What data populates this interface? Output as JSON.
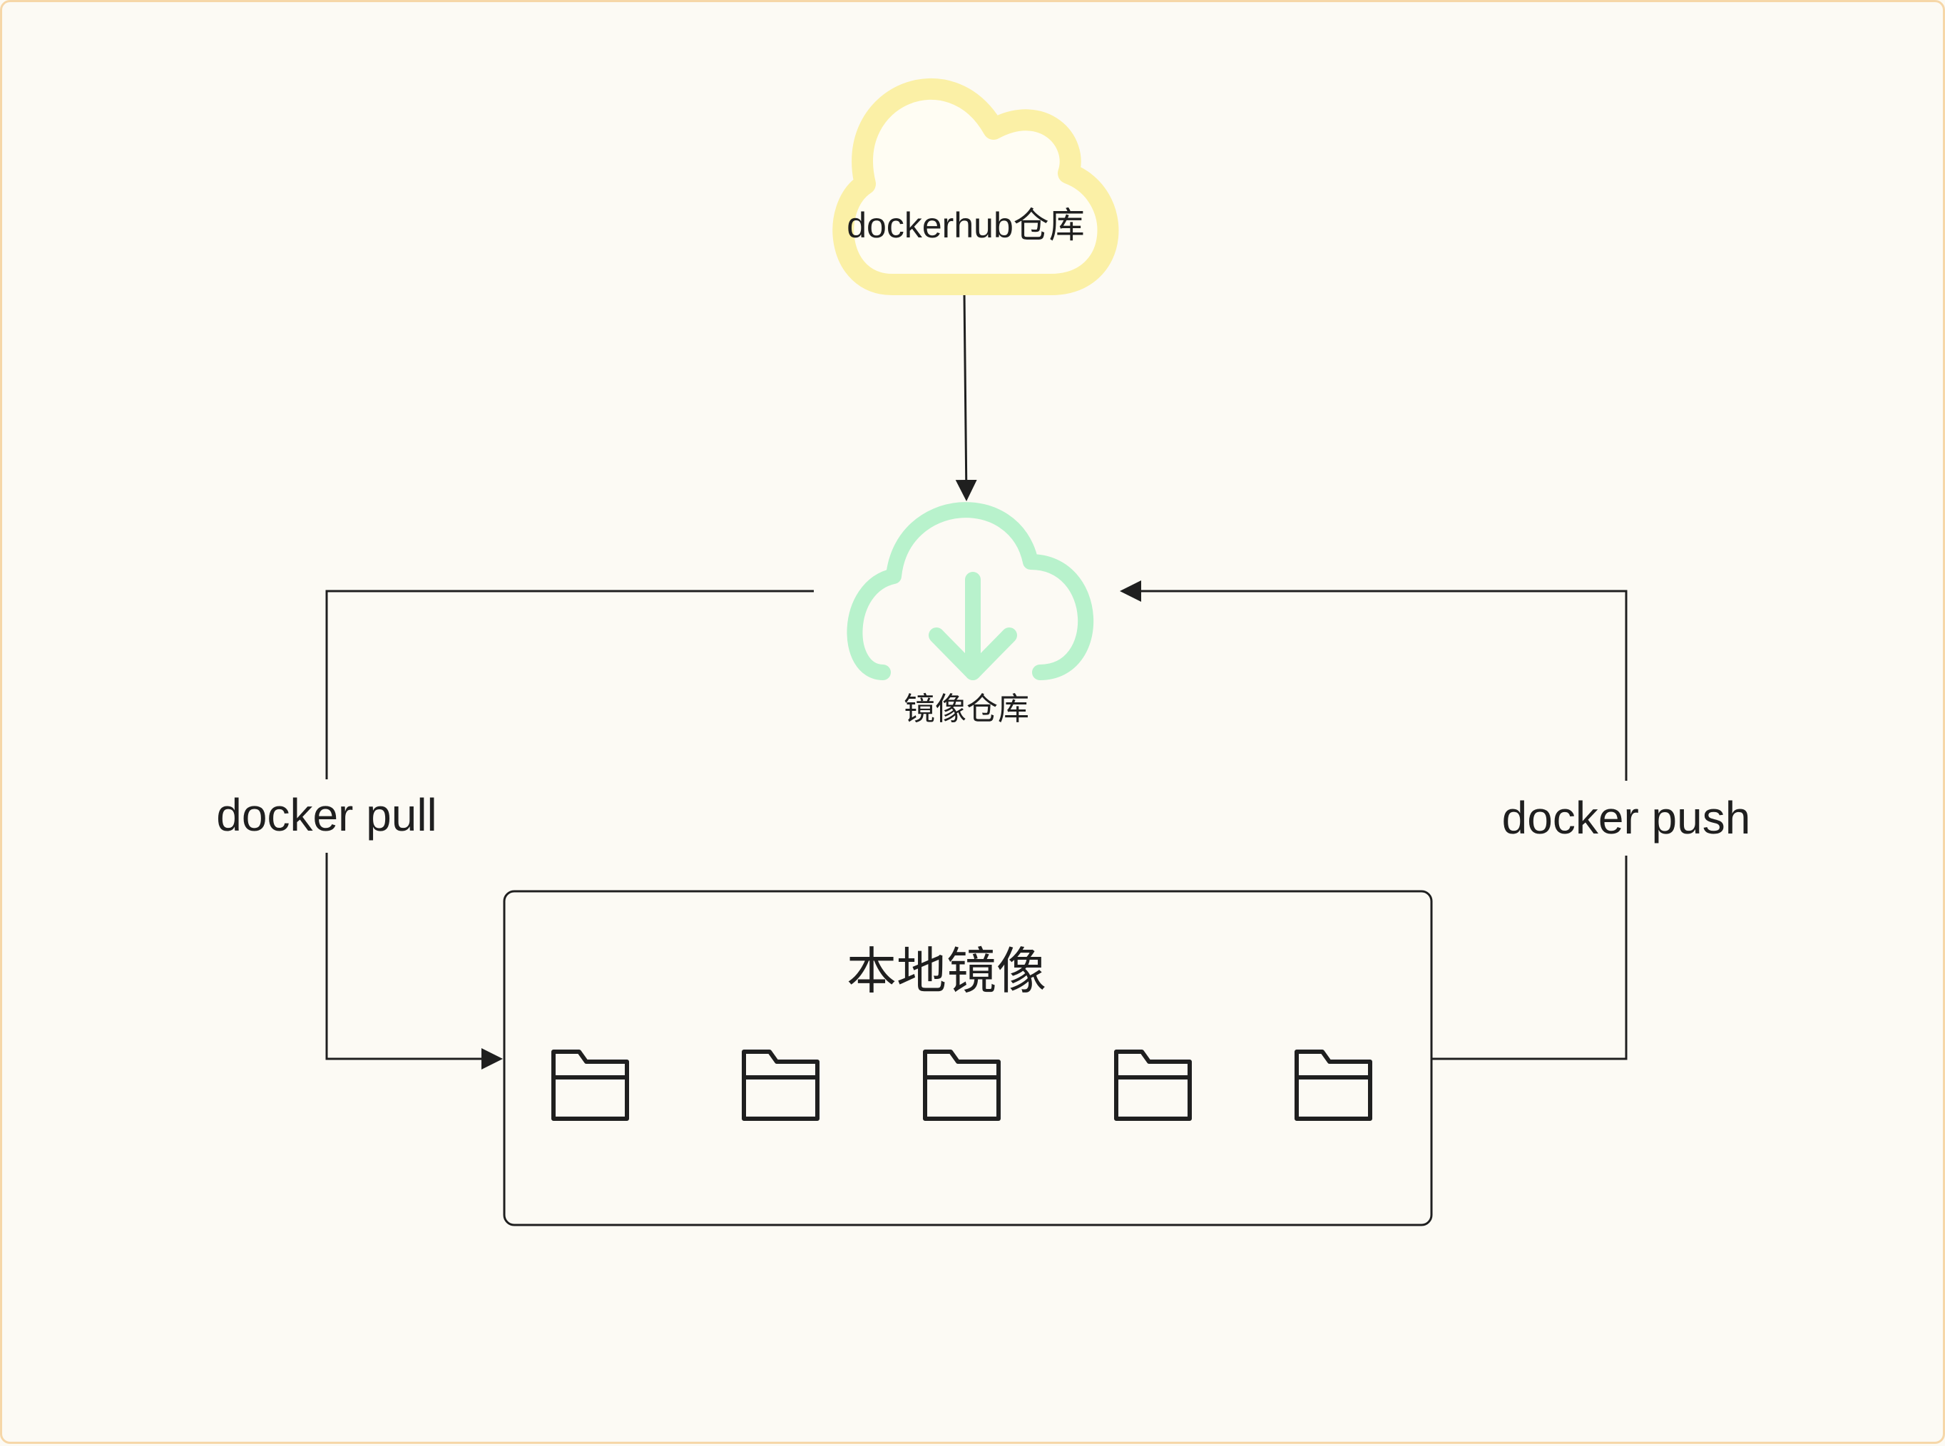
{
  "diagram": {
    "hub_cloud": {
      "label": "dockerhub仓库",
      "color": "#fbf0a6"
    },
    "repo_cloud": {
      "label": "镜像仓库",
      "color": "#b8f2cc"
    },
    "local_images": {
      "title": "本地镜像",
      "folder_count": 5
    },
    "edges": {
      "pull_label": "docker pull",
      "push_label": "docker push"
    },
    "colors": {
      "background": "#fcfaf4",
      "border": "#f6d7a8",
      "line": "#1f1f1f"
    }
  }
}
